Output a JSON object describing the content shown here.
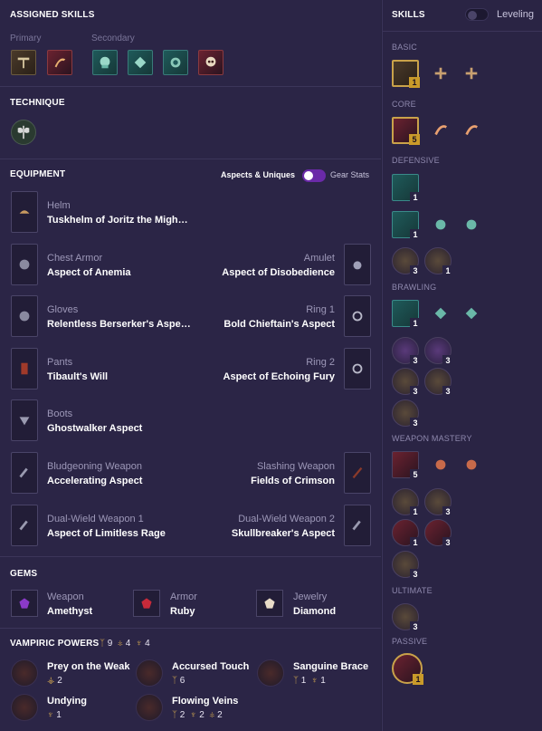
{
  "assigned_skills": {
    "title": "ASSIGNED SKILLS",
    "primary_label": "Primary",
    "secondary_label": "Secondary"
  },
  "technique": {
    "title": "TECHNIQUE"
  },
  "equipment": {
    "title": "EQUIPMENT",
    "toggle_left": "Aspects & Uniques",
    "toggle_right": "Gear Stats",
    "left": [
      {
        "type": "Helm",
        "name": "Tuskhelm of Joritz the Migh…"
      },
      {
        "type": "Chest Armor",
        "name": "Aspect of Anemia"
      },
      {
        "type": "Gloves",
        "name": "Relentless Berserker's Aspe…"
      },
      {
        "type": "Pants",
        "name": "Tibault's Will"
      },
      {
        "type": "Boots",
        "name": "Ghostwalker Aspect"
      },
      {
        "type": "Bludgeoning Weapon",
        "name": "Accelerating Aspect"
      },
      {
        "type": "Dual-Wield Weapon 1",
        "name": "Aspect of Limitless Rage"
      }
    ],
    "right": [
      {
        "type": "Amulet",
        "name": "Aspect of Disobedience"
      },
      {
        "type": "Ring 1",
        "name": "Bold Chieftain's Aspect"
      },
      {
        "type": "Ring 2",
        "name": "Aspect of Echoing Fury"
      },
      {
        "type": "Slashing Weapon",
        "name": "Fields of Crimson"
      },
      {
        "type": "Dual-Wield Weapon 2",
        "name": "Skullbreaker's Aspect"
      }
    ]
  },
  "gems": {
    "title": "GEMS",
    "items": [
      {
        "type": "Weapon",
        "name": "Amethyst"
      },
      {
        "type": "Armor",
        "name": "Ruby"
      },
      {
        "type": "Jewelry",
        "name": "Diamond"
      }
    ]
  },
  "vampiric": {
    "title": "VAMPIRIC POWERS",
    "totals": [
      "9",
      "4",
      "4"
    ],
    "powers": [
      {
        "name": "Prey on the Weak",
        "cost": [
          "2"
        ]
      },
      {
        "name": "Accursed Touch",
        "cost": [
          "6"
        ]
      },
      {
        "name": "Sanguine Brace",
        "cost": [
          "1",
          "1"
        ]
      },
      {
        "name": "Undying",
        "cost": [
          "1"
        ]
      },
      {
        "name": "Flowing Veins",
        "cost": [
          "2",
          "2",
          "2"
        ]
      }
    ]
  },
  "skills_panel": {
    "title": "SKILLS",
    "toggle_label": "Leveling",
    "sections": [
      "BASIC",
      "CORE",
      "DEFENSIVE",
      "BRAWLING",
      "WEAPON MASTERY",
      "ULTIMATE",
      "PASSIVE"
    ],
    "badges": {
      "basic": "1",
      "core": "5",
      "def1": "1",
      "def2": "1",
      "def3a": "3",
      "def3b": "1",
      "br1": "1",
      "br2a": "3",
      "br2b": "3",
      "br3a": "3",
      "br3b": "3",
      "br4": "3",
      "wm1": "5",
      "wm2a": "1",
      "wm2b": "3",
      "wm3a": "1",
      "wm3b": "3",
      "wm4": "3",
      "ult": "3",
      "passive": "1"
    }
  }
}
